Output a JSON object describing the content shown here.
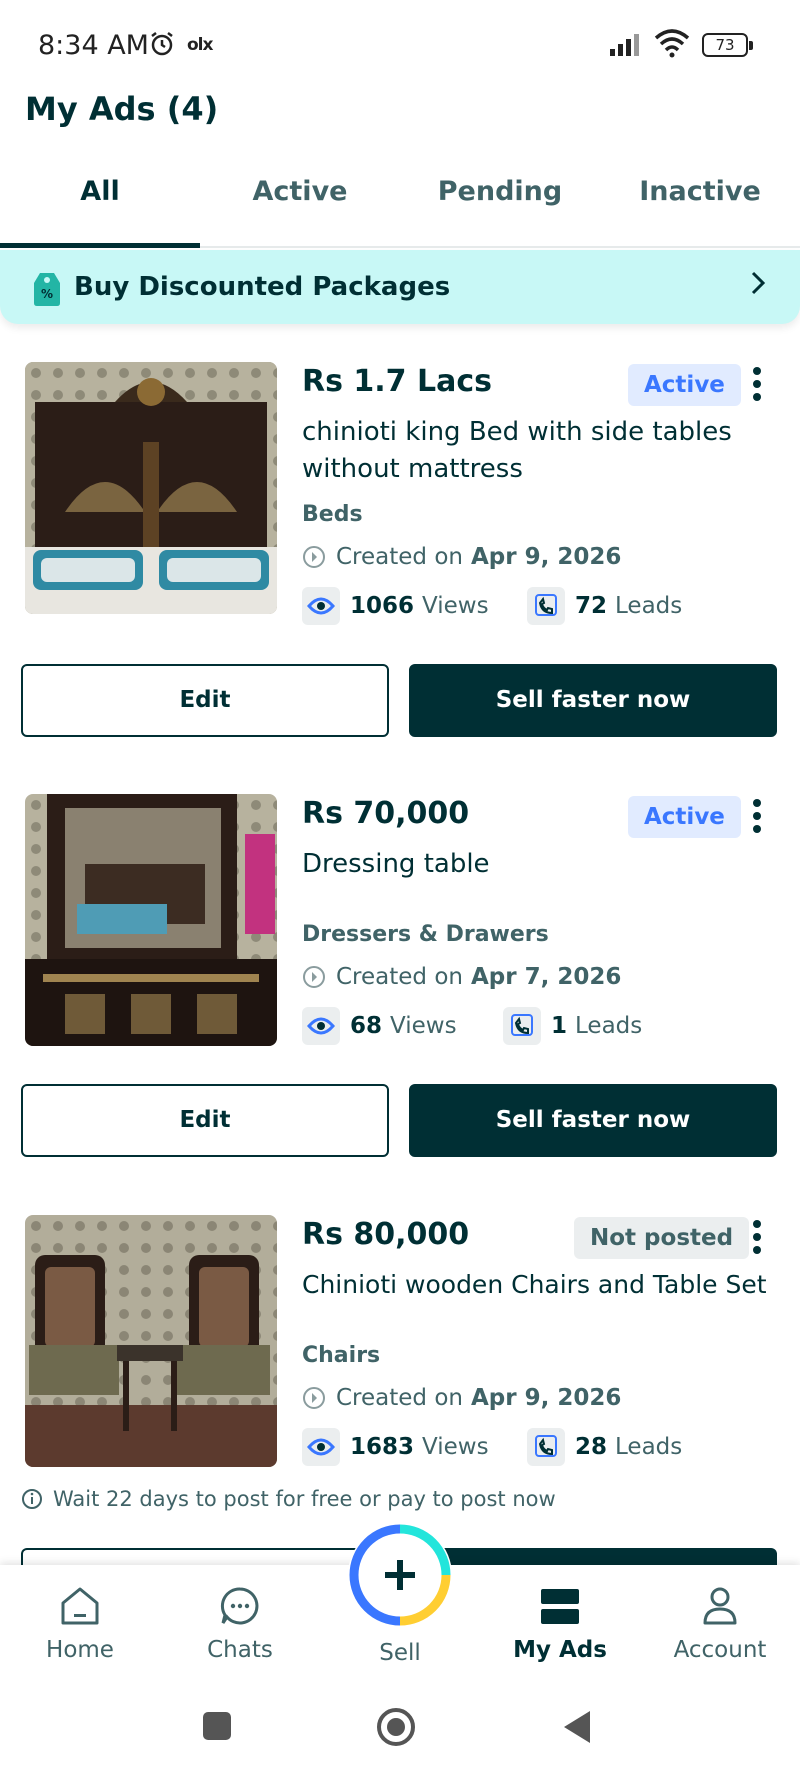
{
  "status_bar": {
    "time": "8:34 AM",
    "battery": "73",
    "app_mini_logo": "olx"
  },
  "header": {
    "title": "My Ads (4)"
  },
  "tabs": [
    {
      "label": "All",
      "active": true
    },
    {
      "label": "Active",
      "active": false
    },
    {
      "label": "Pending",
      "active": false
    },
    {
      "label": "Inactive",
      "active": false
    }
  ],
  "promo": {
    "label": "Buy Discounted Packages",
    "icon": "discount-tag-icon"
  },
  "ads": [
    {
      "price": "Rs 1.7 Lacs",
      "status": "Active",
      "title": "chinioti king Bed with side tables without mattress",
      "category": "Beds",
      "created_prefix": "Created on",
      "created_date": "Apr 9, 2026",
      "views": "1066",
      "views_label": "Views",
      "leads": "72",
      "leads_label": "Leads",
      "edit_label": "Edit",
      "sell_label": "Sell faster now"
    },
    {
      "price": "Rs 70,000",
      "status": "Active",
      "title": "Dressing table",
      "category": "Dressers & Drawers",
      "created_prefix": "Created on",
      "created_date": "Apr 7, 2026",
      "views": "68",
      "views_label": "Views",
      "leads": "1",
      "leads_label": "Leads",
      "edit_label": "Edit",
      "sell_label": "Sell faster now"
    },
    {
      "price": "Rs 80,000",
      "status": "Not posted",
      "title": "Chinioti wooden Chairs and Table Set",
      "category": "Chairs",
      "created_prefix": "Created on",
      "created_date": "Apr 9, 2026",
      "views": "1683",
      "views_label": "Views",
      "leads": "28",
      "leads_label": "Leads",
      "notice": "Wait 22 days to post for free or pay to post now"
    }
  ],
  "bottom_nav": [
    {
      "label": "Home",
      "icon": "home-icon"
    },
    {
      "label": "Chats",
      "icon": "chat-icon"
    },
    {
      "label": "Sell",
      "icon": "plus-icon"
    },
    {
      "label": "My Ads",
      "icon": "my-ads-icon",
      "active": true
    },
    {
      "label": "Account",
      "icon": "account-icon"
    }
  ],
  "colors": {
    "primary": "#002f34",
    "secondary_text": "#406367",
    "active_badge": "#3a77ff",
    "promo_bg": "#c8f8f6"
  }
}
